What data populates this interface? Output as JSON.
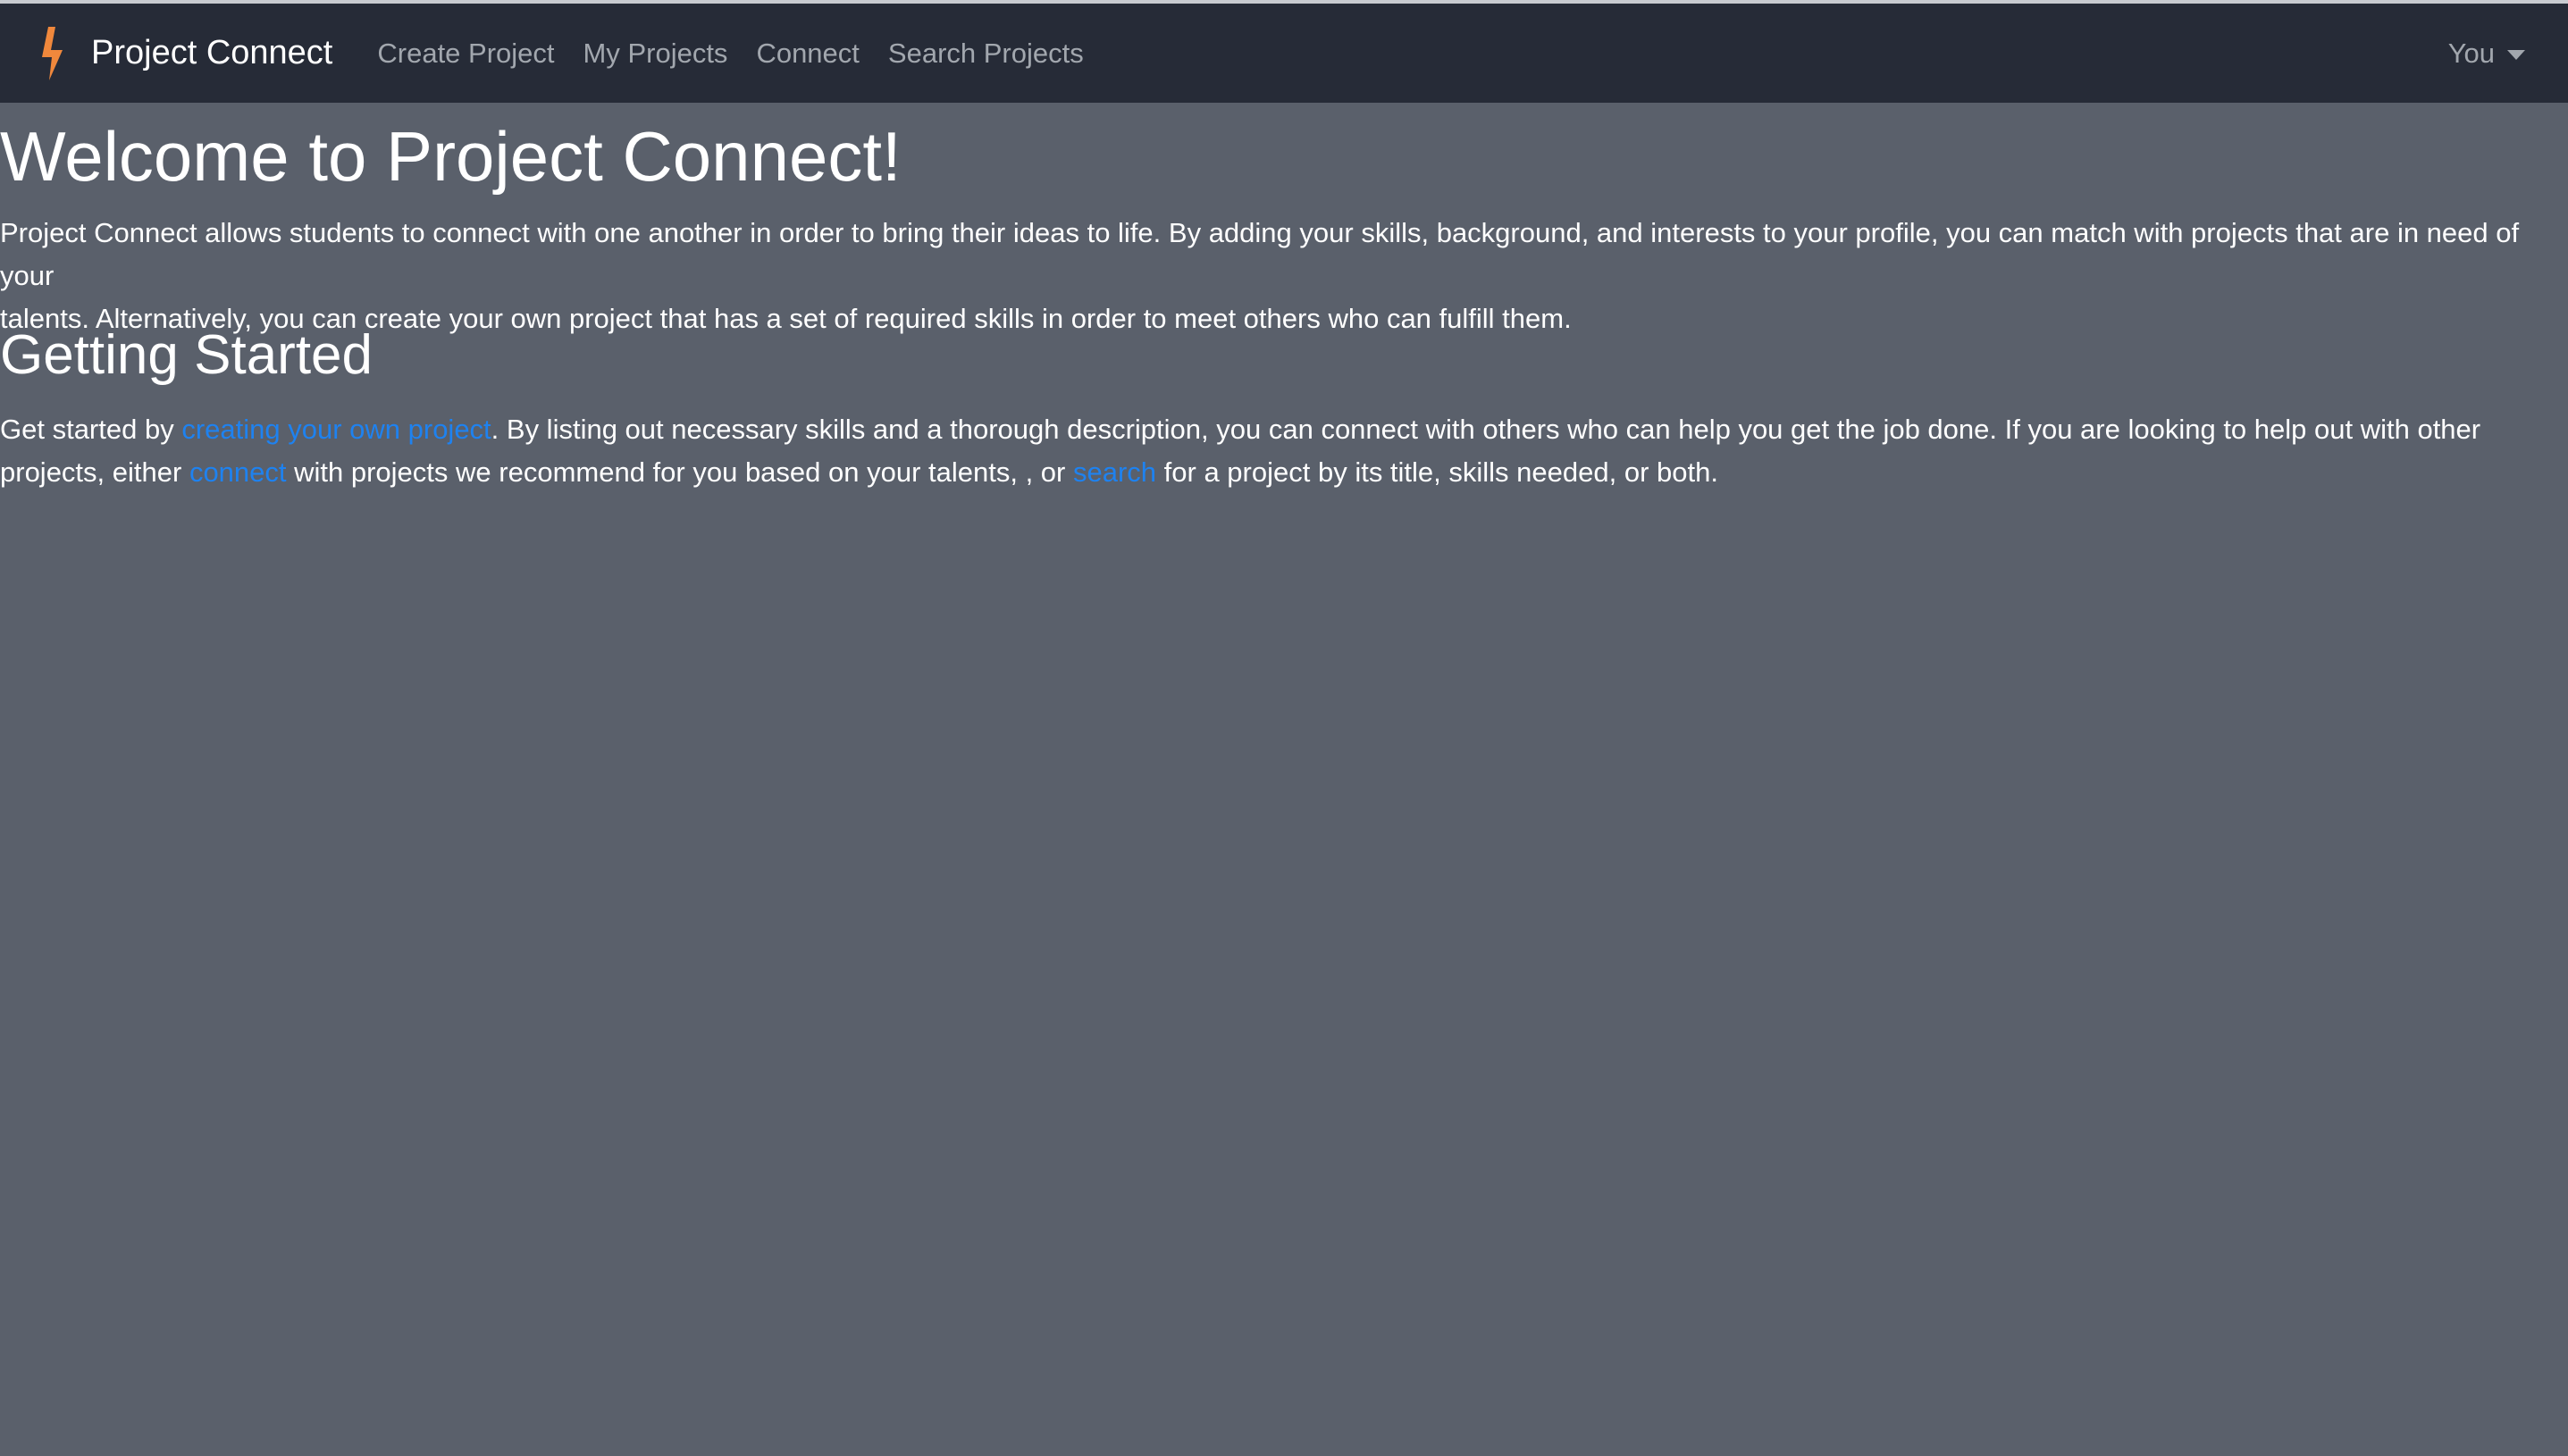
{
  "navbar": {
    "brand_icon": "lightning-bolt-icon",
    "brand_name": "Project Connect",
    "links": [
      {
        "label": "Create Project"
      },
      {
        "label": "My Projects"
      },
      {
        "label": "Connect"
      },
      {
        "label": "Search Projects"
      }
    ],
    "user_menu_label": "You",
    "user_menu_icon": "caret-down-icon"
  },
  "main": {
    "title": "Welcome to Project Connect!",
    "intro_line1": "Project Connect allows students to connect with one another in order to bring their ideas to life. By adding your skills, background, and interests to your profile, you can match with projects that are in need of your",
    "intro_line2": "talents. Alternatively, you can create your own project that has a set of required skills in order to meet others who can fulfill them.",
    "section_title": "Getting Started",
    "getting_started": {
      "text_1": "Get started by ",
      "link_create": "creating your own project",
      "text_2": ". By listing out necessary skills and a thorough description, you can connect with others who can help you get the job done. If you are looking to help out with other",
      "text_3": "projects, either ",
      "link_connect": "connect",
      "text_4": " with projects we recommend for you based on your talents, , or ",
      "link_search": "search",
      "text_5": " for a project by its title, skills needed, or both."
    }
  },
  "colors": {
    "background": "#5a606b",
    "navbar": "#262b37",
    "nav_link": "#a2a7ae",
    "link": "#1e82f0",
    "brand_icon": "#f0883c"
  }
}
